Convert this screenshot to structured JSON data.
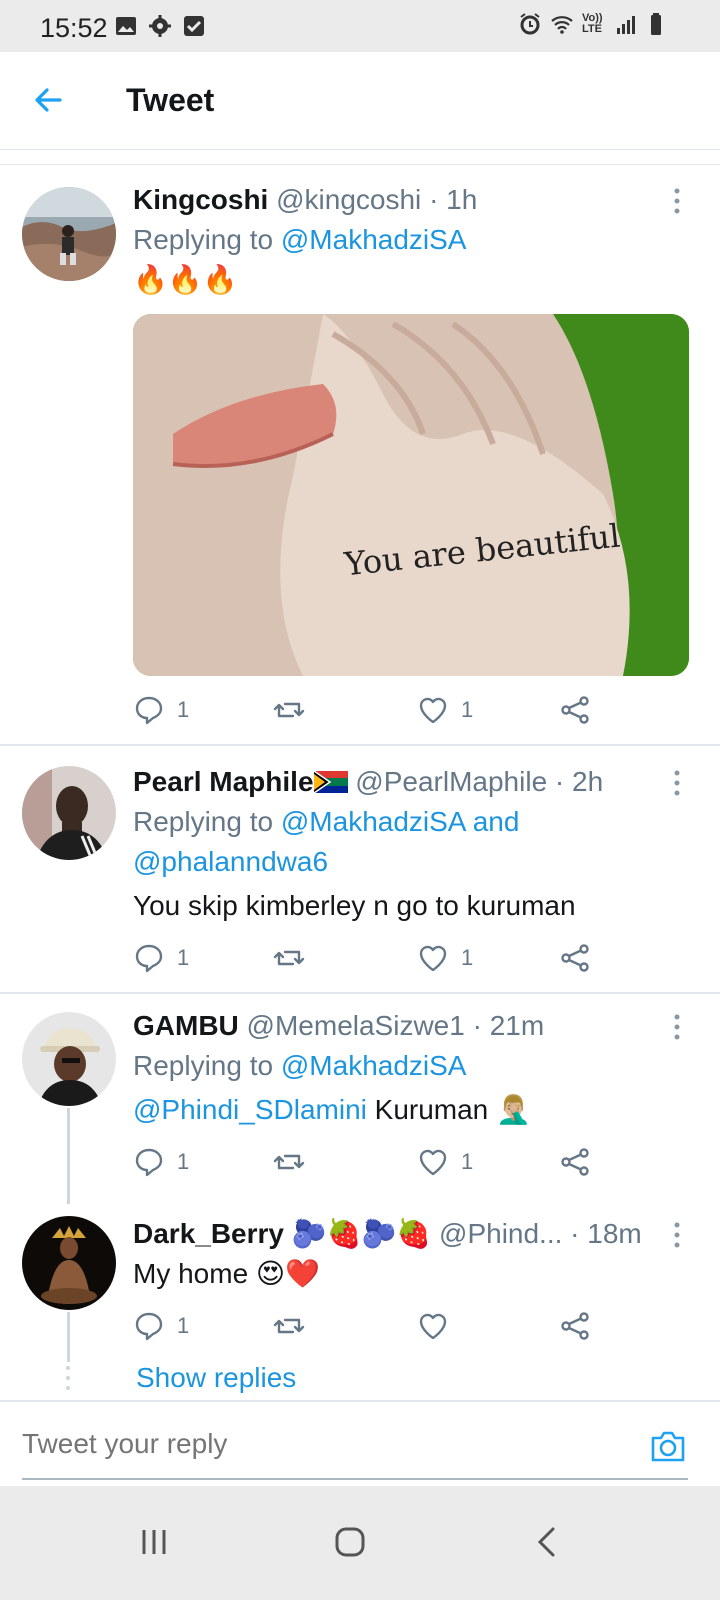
{
  "status_bar": {
    "time": "15:52",
    "network_label": "Vo)) LTE"
  },
  "header": {
    "title": "Tweet"
  },
  "colors": {
    "link": "#1b95e0",
    "meta": "#657786",
    "divider": "#e1e8ed"
  },
  "tweets": [
    {
      "name": "Kingcoshi",
      "handle": "@kingcoshi",
      "time": "· 1h",
      "replying_prefix": "Replying to ",
      "replying_to": "@MakhadziSA",
      "text": "🔥🔥🔥",
      "image_text": "You are beautiful",
      "reply_count": "1",
      "retweet_count": "",
      "like_count": "1"
    },
    {
      "name": "Pearl Maphile",
      "name_emoji": "flag-south-africa",
      "handle": "@PearlMaphile",
      "time": "· 2h",
      "replying_prefix": "Replying to ",
      "replying_to": "@MakhadziSA and",
      "replying_to_2": "@phalanndwa6",
      "text": "You skip kimberley n go to kuruman",
      "reply_count": "1",
      "retweet_count": "",
      "like_count": "1"
    },
    {
      "name": "GAMBU",
      "handle": "@MemelaSizwe1",
      "time": "· 21m",
      "replying_prefix": "Replying to ",
      "replying_to": "@MakhadziSA",
      "mention": "@Phindi_SDlamini",
      "text": " Kuruman 🤦🏼‍♂️",
      "reply_count": "1",
      "retweet_count": "",
      "like_count": "1"
    },
    {
      "name": "Dark_Berry",
      "name_emoji": "🫐🍓🫐🍓",
      "handle": "@Phind...",
      "time": "· 18m",
      "text": "My home 😍❤️",
      "reply_count": "1",
      "retweet_count": "",
      "like_count": ""
    }
  ],
  "show_replies": "Show replies",
  "composer": {
    "placeholder": "Tweet your reply"
  }
}
